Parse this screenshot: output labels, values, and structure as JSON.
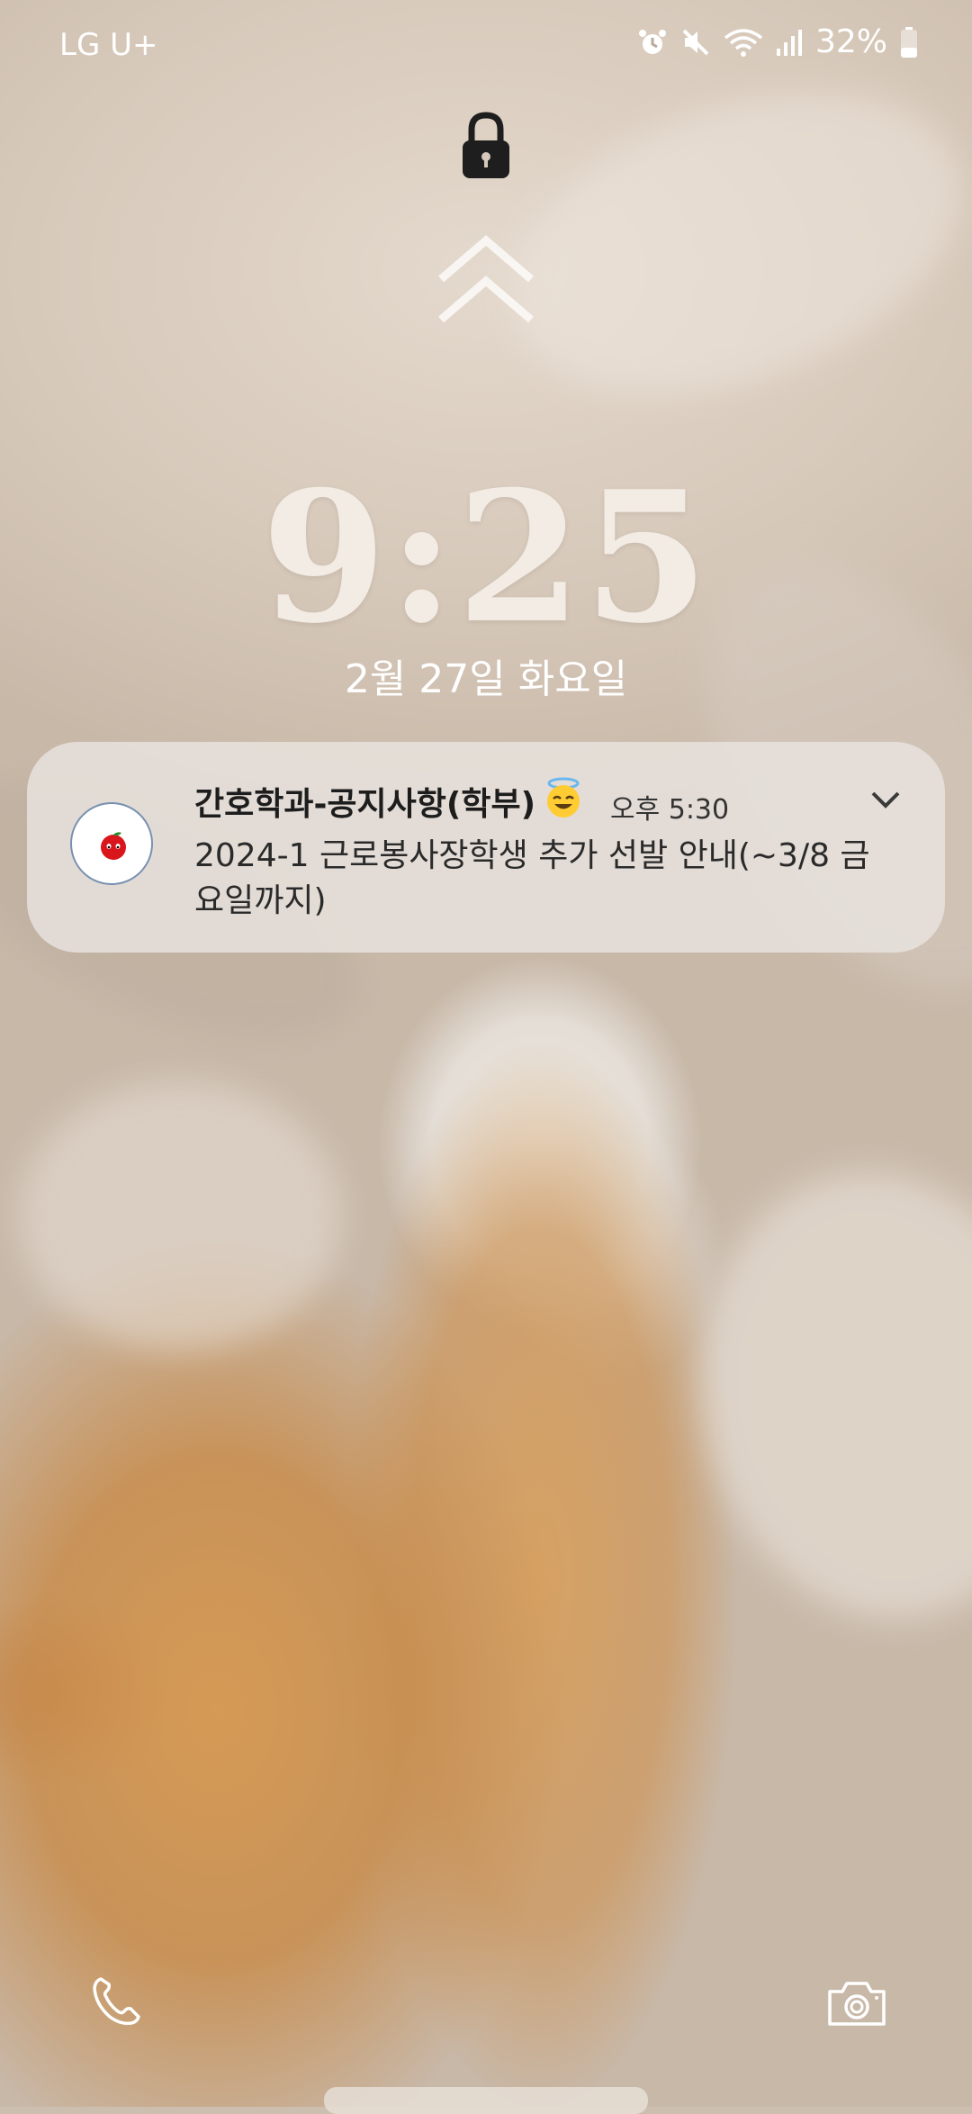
{
  "status_bar": {
    "carrier": "LG U+",
    "battery": "32%",
    "icons": [
      "alarm-icon",
      "mute-icon",
      "wifi-icon",
      "signal-icon",
      "battery-icon"
    ]
  },
  "lockscreen": {
    "time": "9:25",
    "date": "2월 27일 화요일"
  },
  "notification": {
    "app_name": "간호학과-공지사항(학부)",
    "emoji": "smiling-face-with-halo",
    "time": "오후 5:30",
    "body": "2024-1 근로봉사장학생 추가 선발 안내(~3/8 금요일까지)"
  },
  "shortcuts": {
    "left": "phone-icon",
    "right": "camera-icon"
  },
  "colors": {
    "clock": "#f3ece4",
    "notification_bg": "#e8e2dd"
  }
}
